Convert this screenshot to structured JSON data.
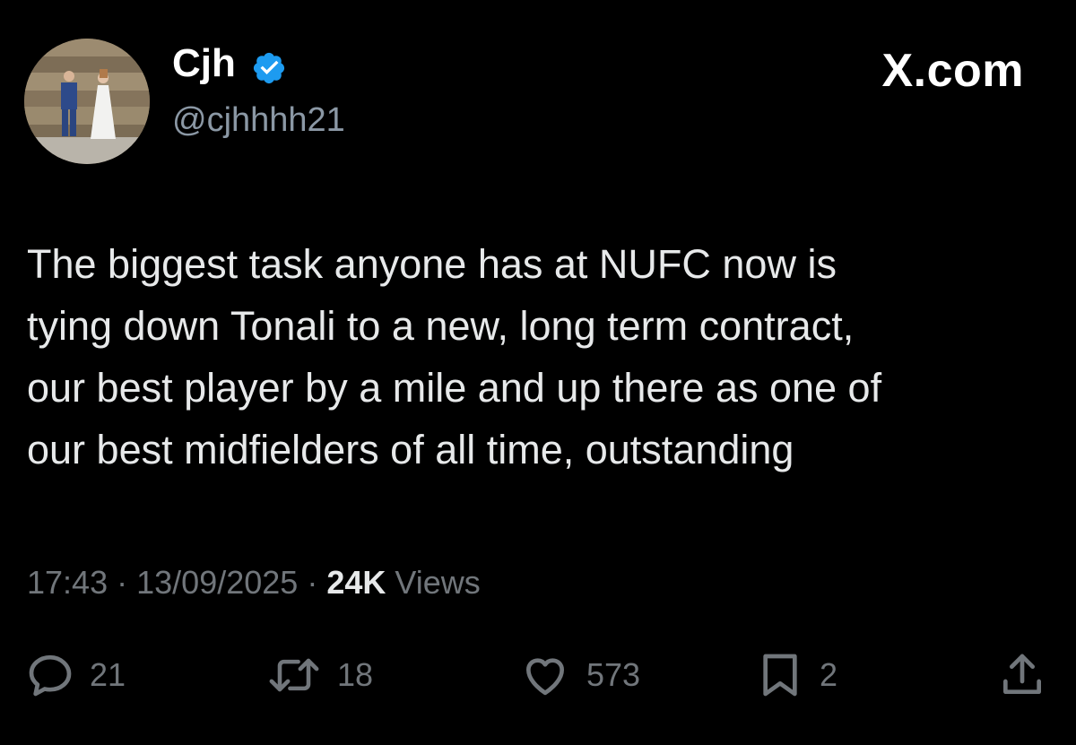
{
  "header": {
    "display_name": "Cjh",
    "handle": "@cjhhhh21",
    "brand": "X.com",
    "verified": true,
    "accent_color": "#1d9bf0"
  },
  "tweet": {
    "lines": [
      "The biggest task anyone has at NUFC now is",
      "tying down Tonali to a new, long term contract,",
      "our best player by a mile and up there as one of",
      "our best midfielders of all time, outstanding"
    ]
  },
  "meta": {
    "time": "17:43",
    "date": "13/09/2025",
    "separator": "·",
    "views_count": "24K",
    "views_label": "Views"
  },
  "actions": {
    "replies": "21",
    "reposts": "18",
    "likes": "573",
    "bookmarks": "2",
    "icons": [
      "reply-icon",
      "repost-icon",
      "like-icon",
      "bookmark-icon",
      "share-icon"
    ]
  }
}
